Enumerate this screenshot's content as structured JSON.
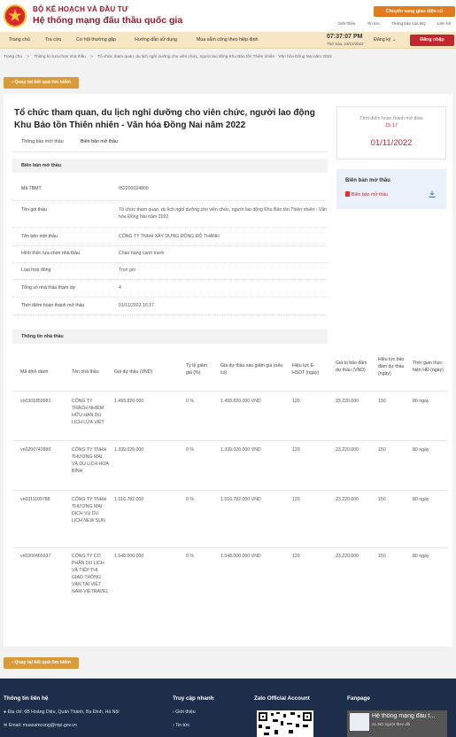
{
  "header": {
    "org_line1": "BỘ KẾ HOẠCH VÀ ĐẦU TƯ",
    "org_line2": "Hệ thống mạng đấu thầu quốc gia",
    "switch_button": "Chuyển sang giao diện cũ",
    "top_links": [
      "Giới thiệu",
      "Tin tức",
      "Thông báo của BQ",
      "Liên hệ"
    ]
  },
  "nav": {
    "items": [
      "Trang chủ",
      "Tra cứu",
      "Cơ hội thường gặp",
      "Hướng dẫn sử dụng",
      "Mua sắm công theo hiệp định"
    ],
    "clock_time": "07:37:07 PM",
    "clock_date": "Thứ Sáu, 23/12/2022",
    "register": "Đăng ký",
    "login": "Đăng nhập"
  },
  "breadcrumb": [
    "Trang chủ",
    ">",
    "Thông tin lựa chọn nhà thầu",
    ">",
    "Tổ chức tham quan, du lịch nghỉ dưỡng cho viên chức, người lao động Khu Bảo tồn Thiên nhiên - Văn hóa Đồng Nai năm 2022"
  ],
  "back_button": "Quay lại kết quả tìm kiếm",
  "main": {
    "title": "Tổ chức tham quan, du lịch nghỉ dưỡng cho viên chức, người lao động Khu Bảo tồn Thiên nhiên - Văn hóa Đồng Nai năm 2022",
    "tabs": [
      "Thông báo mời thầu",
      "Biên bản mở thầu"
    ],
    "section_minutes": "Biên bản mở thầu",
    "fields": [
      {
        "label": "Mã TBMT",
        "value": "IB2200024809"
      },
      {
        "label": "Tên gói thầu",
        "value": "Tổ chức tham quan, du lịch nghỉ dưỡng cho viên chức, người lao động Khu Bảo tồn Thiên nhiên - Văn hóa Đồng Nai năm 2022"
      },
      {
        "label": "Tên bên mời thầu",
        "value": "CÔNG TY TNHH XÂY DỰNG ĐÔNG ĐÔ THÀNH"
      },
      {
        "label": "Hình thức lựa chọn nhà thầu",
        "value": "Chào hàng cạnh tranh"
      },
      {
        "label": "Loại hợp đồng",
        "value": "Trọn gói"
      },
      {
        "label": "Tổng số nhà thầu tham dự",
        "value": "4"
      },
      {
        "label": "Thời điểm hoàn thành mở thầu",
        "value": "01/11/2022 15:17"
      }
    ],
    "section_bidders": "Thông tin nhà thầu"
  },
  "side": {
    "deadline_label": "Thời điểm hoàn thành mở thầu",
    "deadline_time": "15:17",
    "deadline_date": "01/11/2022",
    "file_title": "Biên bản mở thầu",
    "file_link": "Biên bản mở thầu"
  },
  "table": {
    "headers": [
      "Mã định danh",
      "Tên nhà thầu",
      "Giá dự thầu (VND)",
      "Tỷ lệ giảm giá (%)",
      "Giá dự thầu sau giảm giá (nếu có)",
      "Hiệu lực E-HSDT (ngày)",
      "Giá trị bảo đảm dự thầu (VND)",
      "Hiệu lực bảo đảm dự thầu (ngày)",
      "Thời gian thực hiện HĐ (ngày)"
    ],
    "rows": [
      {
        "id": "vn0301859981",
        "name": "CÔNG TY TRÁCH NHIỆM HỮU HẠN DU LỊCH LỬA VIỆT",
        "price": "1.493.820.000",
        "discount": "0 %",
        "after": "1.493.820.000 VND",
        "validity": "120",
        "guarantee": "23.220.000",
        "g_validity": "150",
        "duration": "80 ngày"
      },
      {
        "id": "vn0200742880",
        "name": "CÔNG TY TNHH THƯƠNG MẠI VÀ DU LỊCH HOÀ BÌNH",
        "price": "1.339.020.000",
        "discount": "0 %",
        "after": "1.339.020.000 VND",
        "validity": "120",
        "guarantee": "23.220.000",
        "g_validity": "150",
        "duration": "80 ngày"
      },
      {
        "id": "vn0311109788",
        "name": "CÔNG TY TNHH THƯƠNG MẠI DỊCH VỤ DU LỊCH NEW SUN",
        "price": "1.516.782.000",
        "discount": "0 %",
        "after": "1.516.782.000 VND",
        "validity": "120",
        "guarantee": "23.220.000",
        "g_validity": "150",
        "duration": "80 ngày"
      },
      {
        "id": "vn0300465937",
        "name": "CÔNG TY CỔ PHẦN DU LỊCH VÀ TIẾP THỊ GIAO THÔNG VẬN TẢI VIỆT NAM-VIETRAVEL",
        "price": "1.548.000.000",
        "discount": "0 %",
        "after": "1.548.000.000 VND",
        "validity": "120",
        "guarantee": "23.220.000",
        "g_validity": "150",
        "duration": "80 ngày"
      }
    ]
  },
  "footer": {
    "contact_title": "Thông tin liên hệ",
    "address": "Địa chỉ: 6B Hoàng Diệu, Quán Thánh, Ba Đình, Hà Nội",
    "email": "Email: muasamcong@mpi.gov.vn",
    "quick_title": "Truy cập nhanh",
    "quick_links": [
      "Giới thiệu",
      "Tin tức"
    ],
    "zalo_title": "Zalo Official Account",
    "fanpage_title": "Fanpage",
    "fanpage_name": "Hệ thống mạng đấu t...",
    "fanpage_likes": "21.361 người theo dõi"
  }
}
